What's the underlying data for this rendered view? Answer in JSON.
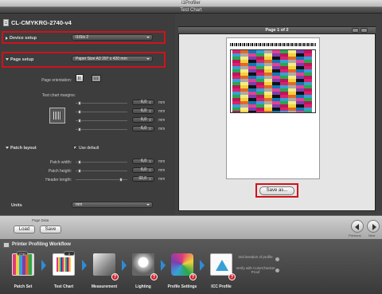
{
  "app": {
    "title": "i1Profiler"
  },
  "section": {
    "title": "Test Chart"
  },
  "document": {
    "name": "CL-CMYKRG-2740-v4"
  },
  "device_setup": {
    "label": "Device setup",
    "value": "i1iSis 2"
  },
  "page_setup": {
    "label": "Page setup",
    "value": "Paper Size A3 297 x 420 mm"
  },
  "orientation": {
    "label": "Page orientation:"
  },
  "margins": {
    "label": "Test chart margins:",
    "fields": [
      {
        "value": "6,0",
        "unit": "mm",
        "slider_level": 0.05
      },
      {
        "value": "6,0",
        "unit": "mm",
        "slider_level": 0.05
      },
      {
        "value": "6,0",
        "unit": "mm",
        "slider_level": 0.05
      },
      {
        "value": "6,0",
        "unit": "mm",
        "slider_level": 0.05
      }
    ]
  },
  "patch_layout": {
    "label": "Patch layout",
    "use_default_label": "Use default",
    "use_default_checked": true,
    "patch_width": {
      "label": "Patch width:",
      "value": "6,0",
      "unit": "mm",
      "slider_level": 0.05
    },
    "patch_height": {
      "label": "Patch height:",
      "value": "6,0",
      "unit": "mm",
      "slider_level": 0.05
    },
    "header_length": {
      "label": "Header length:",
      "value": "32,0",
      "unit": "mm",
      "slider_level": 0.9
    }
  },
  "units": {
    "label": "Units",
    "value": "mm"
  },
  "preview": {
    "page_text": "Page 1 of 2",
    "save_label": "Save as..."
  },
  "page_data": {
    "label": "Page Data",
    "load_label": "Load",
    "save_label": "Save"
  },
  "nav": {
    "previous_label": "Previous",
    "next_label": "Next"
  },
  "workflow": {
    "title": "Printer Profiling Workflow",
    "steps": [
      {
        "label": "Patch Set",
        "badge": "2740"
      },
      {
        "label": "Test Chart",
        "badge": "2"
      },
      {
        "label": "Measurement"
      },
      {
        "label": "Lighting"
      },
      {
        "label": "Profile Settings"
      },
      {
        "label": "ICC Profile"
      }
    ],
    "side_note_1": "2nd iteration of profile",
    "side_note_2": "Verify with ColorChecker Proof",
    "alert_glyph": "?"
  },
  "colors": {
    "highlight_red": "#d0121b",
    "workflow_arrow": "#2d8cd8"
  }
}
